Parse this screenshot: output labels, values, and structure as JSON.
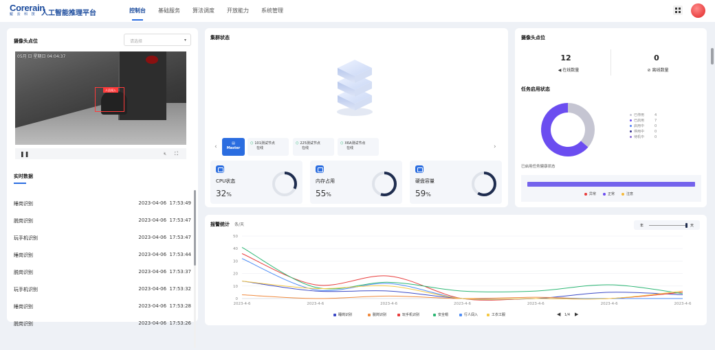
{
  "brand": {
    "logo_main": "Corerain",
    "logo_sub": "鲲 云 科 技",
    "app_title": "人工智能推理平台"
  },
  "nav": {
    "items": [
      "控制台",
      "基础服务",
      "算法调度",
      "开放能力",
      "系统管理"
    ]
  },
  "camera_panel": {
    "title": "摄像头点位",
    "select_placeholder": "请选择",
    "video_timestamp": "05月 日 星期日 04:04:37",
    "detection_label": "人员闯入"
  },
  "realtime": {
    "title": "实时数据",
    "rows": [
      {
        "name": "睡岗识别",
        "date": "2023-04-06",
        "time": "17:53:49"
      },
      {
        "name": "脱岗识别",
        "date": "2023-04-06",
        "time": "17:53:47"
      },
      {
        "name": "玩手机识别",
        "date": "2023-04-06",
        "time": "17:53:47"
      },
      {
        "name": "睡岗识别",
        "date": "2023-04-06",
        "time": "17:53:44"
      },
      {
        "name": "脱岗识别",
        "date": "2023-04-06",
        "time": "17:53:37"
      },
      {
        "name": "玩手机识别",
        "date": "2023-04-06",
        "time": "17:53:32"
      },
      {
        "name": "睡岗识别",
        "date": "2023-04-06",
        "time": "17:53:28"
      },
      {
        "name": "脱岗识别",
        "date": "2023-04-06",
        "time": "17:53:26"
      }
    ]
  },
  "cluster": {
    "title": "集群状态",
    "nodes": [
      {
        "name": "Master",
        "status": ""
      },
      {
        "name": "101测试节点",
        "status": "在线"
      },
      {
        "name": "225测试节点",
        "status": "在线"
      },
      {
        "name": "X6A测试节点",
        "status": "在线"
      }
    ],
    "stats": [
      {
        "label": "CPU状态",
        "value": "32",
        "unit": "%",
        "pct": 32
      },
      {
        "label": "内存占用",
        "value": "55",
        "unit": "%",
        "pct": 55
      },
      {
        "label": "硬盘容量",
        "value": "59",
        "unit": "%",
        "pct": 59
      }
    ]
  },
  "camera_stats": {
    "title": "摄像头点位",
    "online_count": "12",
    "online_label": "在线数量",
    "offline_count": "0",
    "offline_label": "离线数量"
  },
  "task_status": {
    "title": "任务启用状态",
    "legend": [
      {
        "label": "已停用",
        "value": "4",
        "color": "#c5c5d2"
      },
      {
        "label": "已启用",
        "value": "7",
        "color": "#6b4df0"
      },
      {
        "label": "启用中",
        "value": "0",
        "color": "#4f7ef5"
      },
      {
        "label": "停用中",
        "value": "0",
        "color": "#34308c"
      },
      {
        "label": "待机中",
        "value": "0",
        "color": "#8a6ad6"
      }
    ],
    "health_title": "已启用任务健康状态",
    "health_legend": [
      {
        "label": "异常",
        "color": "#e83b3b"
      },
      {
        "label": "正常",
        "color": "#6b4df0"
      },
      {
        "label": "注意",
        "color": "#f5b93a"
      }
    ]
  },
  "alarm": {
    "title": "报警统计",
    "subtitle": "条/天",
    "toggle_left": "年",
    "toggle_right": "天",
    "pager": "1/4"
  },
  "chart_data": {
    "type": "line",
    "title": "报警统计",
    "ylabel": "",
    "ylim": [
      0,
      50
    ],
    "yticks": [
      0,
      10,
      20,
      30,
      40,
      50
    ],
    "x": [
      "2023-4-6",
      "2023-4-6",
      "2023-4-6",
      "2023-4-6",
      "2023-4-6",
      "2023-4-6",
      "2023-4-6"
    ],
    "series": [
      {
        "name": "睡岗识别",
        "color": "#3b49c6",
        "values": [
          14,
          6,
          6,
          0,
          0,
          5,
          3
        ]
      },
      {
        "name": "脱岗识别",
        "color": "#f08a3e",
        "values": [
          3,
          0,
          2,
          0,
          1,
          0,
          5
        ]
      },
      {
        "name": "玩手机识别",
        "color": "#e83b3b",
        "values": [
          36,
          11,
          18,
          0,
          0,
          0,
          5
        ]
      },
      {
        "name": "安全帽",
        "color": "#2bb673",
        "values": [
          41,
          9,
          13,
          6,
          6,
          11,
          4
        ]
      },
      {
        "name": "行人闯入",
        "color": "#4f8df5",
        "values": [
          32,
          7,
          12,
          0,
          0,
          0,
          0
        ]
      },
      {
        "name": "工衣工服",
        "color": "#f5c842",
        "values": [
          14,
          8,
          10,
          0,
          0,
          0,
          6
        ]
      }
    ]
  }
}
